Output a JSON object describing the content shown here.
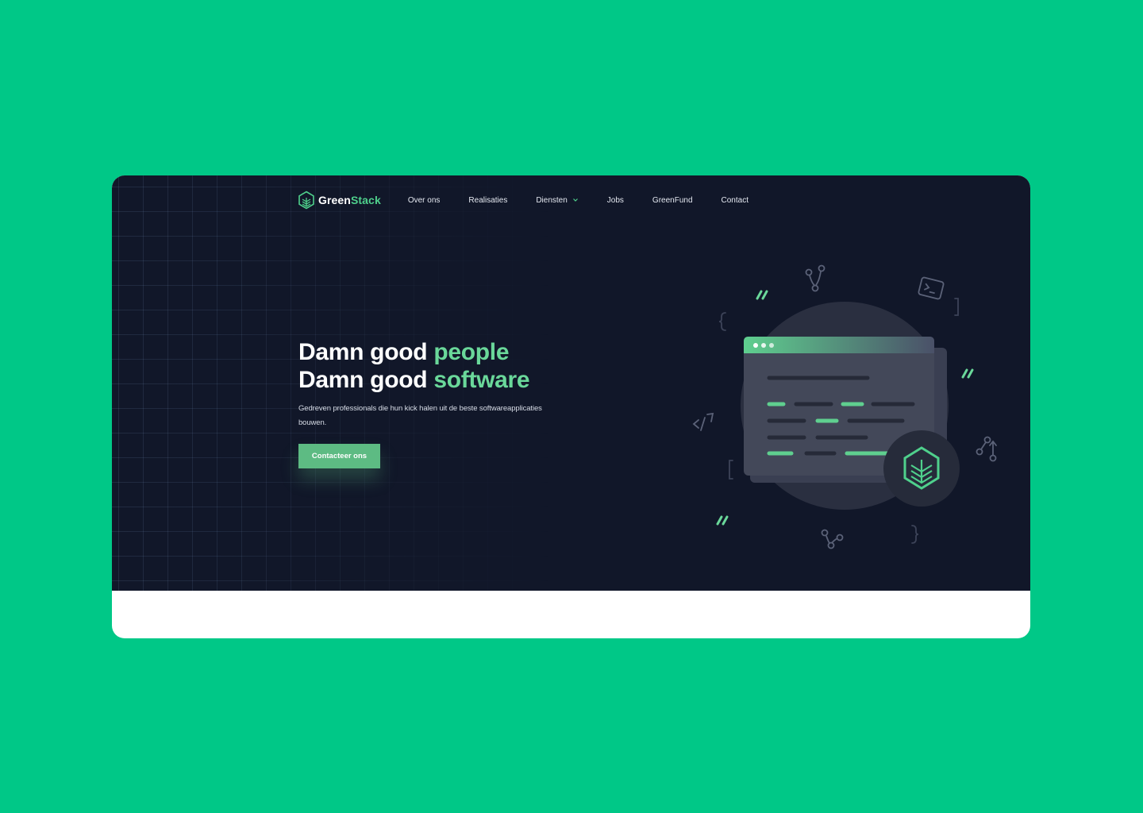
{
  "brand": {
    "name_part1": "Green",
    "name_part2": "Stack",
    "color_primary": "#00c887",
    "color_accent": "#4fd08c"
  },
  "nav": {
    "items": [
      {
        "label": "Over ons"
      },
      {
        "label": "Realisaties"
      },
      {
        "label": "Diensten",
        "has_dropdown": true
      },
      {
        "label": "Jobs"
      },
      {
        "label": "GreenFund"
      },
      {
        "label": "Contact"
      }
    ]
  },
  "hero": {
    "line1_white": "Damn good",
    "line1_green": "people",
    "line2_white": "Damn good",
    "line2_green": "software",
    "subtitle": "Gedreven professionals die hun kick halen uit de beste softwareapplicaties bouwen.",
    "cta_label": "Contacteer ons"
  },
  "illustration": {
    "icons": [
      "git-branch-icon",
      "terminal-icon",
      "code-icon",
      "pull-request-icon",
      "git-merge-icon",
      "browser-window-icon",
      "greenstack-logo-icon"
    ]
  }
}
